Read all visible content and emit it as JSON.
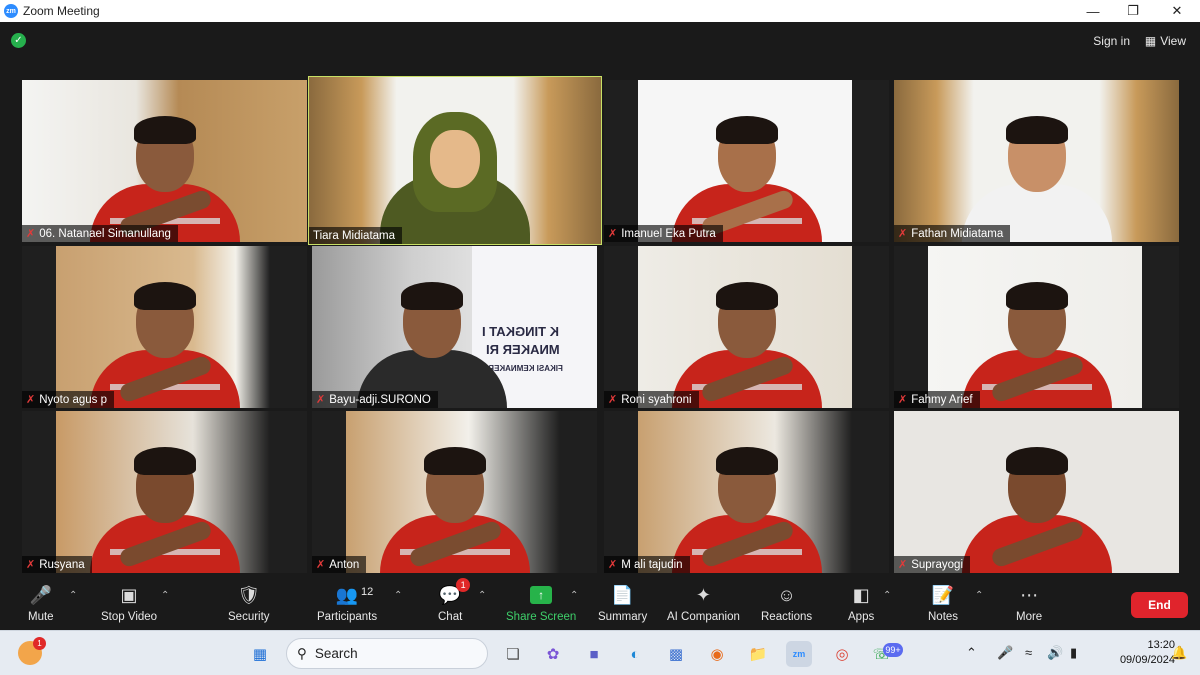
{
  "window": {
    "app_icon": "zm",
    "title": "Zoom Meeting",
    "controls": [
      "minimize",
      "maximize",
      "close"
    ]
  },
  "topbar": {
    "encryption_icon": "shield-check-icon",
    "sign_in": "Sign in",
    "view": "View"
  },
  "participants": [
    {
      "name": "06. Natanael Simanullang",
      "muted": true
    },
    {
      "name": "Tiara Midiatama",
      "muted": false,
      "active_speaker": true
    },
    {
      "name": "Imanuel Eka Putra",
      "muted": true
    },
    {
      "name": "Fathan Midiatama",
      "muted": true
    },
    {
      "name": "Nyoto agus p",
      "muted": true
    },
    {
      "name": "Bayu-adji.SURONO",
      "muted": true
    },
    {
      "name": "Roni syahroni",
      "muted": true
    },
    {
      "name": "Fahmy Arief",
      "muted": true
    },
    {
      "name": "Rusyana",
      "muted": true
    },
    {
      "name": "Anton",
      "muted": true
    },
    {
      "name": "M ali tajudin",
      "muted": true
    },
    {
      "name": "Suprayogi",
      "muted": true
    }
  ],
  "slide_text": {
    "line1": "K TINGKAT I",
    "line2": "MNAKER RI",
    "line3": "FIKASI KEMNAKER RI"
  },
  "toolbar": {
    "mute": "Mute",
    "stop_video": "Stop Video",
    "security": "Security",
    "participants": "Participants",
    "participants_count": "12",
    "chat": "Chat",
    "chat_badge": "1",
    "share_screen": "Share Screen",
    "summary": "Summary",
    "ai_companion": "AI Companion",
    "reactions": "Reactions",
    "apps": "Apps",
    "notes": "Notes",
    "more": "More",
    "end": "End"
  },
  "taskbar": {
    "search": "Search",
    "whatsapp_badge": "99+",
    "weather_badge": "1",
    "time": "13:20",
    "date": "09/09/2024"
  },
  "colors": {
    "accent_green": "#3ecf6a",
    "end_red": "#e0242c",
    "active_speaker_border": "#c8e065",
    "uniform_red": "#c7241b"
  }
}
